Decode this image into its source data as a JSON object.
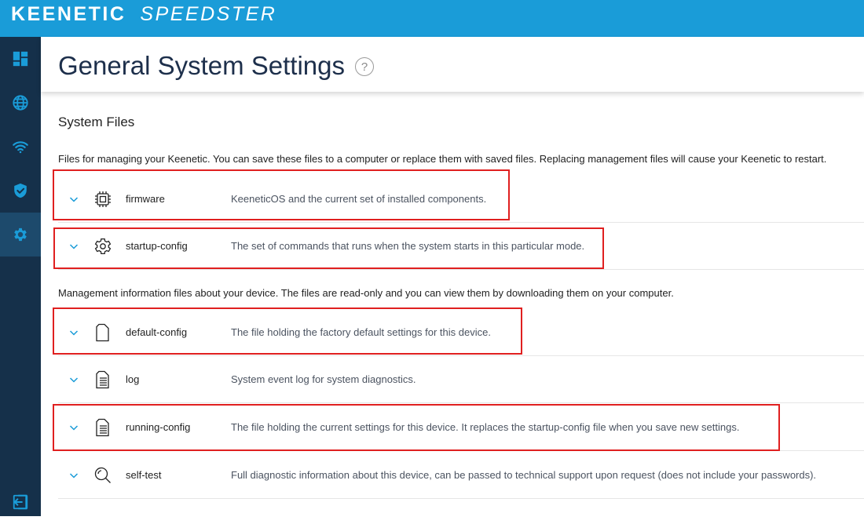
{
  "brand": {
    "name": "KEENETIC",
    "model": "SPEEDSTER"
  },
  "sidebar": {
    "items": [
      {
        "id": "dashboard",
        "icon": "dashboard-icon",
        "active": false
      },
      {
        "id": "internet",
        "icon": "globe-icon",
        "active": false
      },
      {
        "id": "wifi",
        "icon": "wifi-icon",
        "active": false
      },
      {
        "id": "security",
        "icon": "shield-icon",
        "active": false
      },
      {
        "id": "settings",
        "icon": "gear-icon",
        "active": true
      }
    ],
    "bottom_icon": "logout-icon"
  },
  "page": {
    "title": "General System Settings",
    "help_glyph": "?"
  },
  "section": {
    "title": "System Files",
    "desc_management": "Files for managing your Keenetic. You can save these files to a computer or replace them with saved files. Replacing management files will cause your Keenetic to restart.",
    "desc_info": "Management information files about your device. The files are read-only and you can view them by downloading them on your computer."
  },
  "files": [
    {
      "name": "firmware",
      "icon": "chip-icon",
      "desc": "KeeneticOS and the current set of installed components.",
      "highlighted": true
    },
    {
      "name": "startup-config",
      "icon": "gear-file-icon",
      "desc": "The set of commands that runs when the system starts in this particular mode.",
      "highlighted": true
    },
    {
      "name": "default-config",
      "icon": "blank-file-icon",
      "desc": "The file holding the factory default settings for this device.",
      "highlighted": true
    },
    {
      "name": "log",
      "icon": "text-file-icon",
      "desc": "System event log for system diagnostics.",
      "highlighted": false
    },
    {
      "name": "running-config",
      "icon": "text-file-icon",
      "desc": "The file holding the current settings for this device. It replaces the startup-config file when you save new settings.",
      "highlighted": true
    },
    {
      "name": "self-test",
      "icon": "magnifier-icon",
      "desc": "Full diagnostic information about this device, can be passed to technical support upon request (does not include your passwords).",
      "highlighted": false
    }
  ],
  "colors": {
    "topbar": "#1a9cd8",
    "sidebar": "#15304a",
    "sidebar_active": "#1d4a6c",
    "sidebar_icon": "#1a9cd8",
    "highlight": "#e02020",
    "title": "#1d2f4b"
  }
}
